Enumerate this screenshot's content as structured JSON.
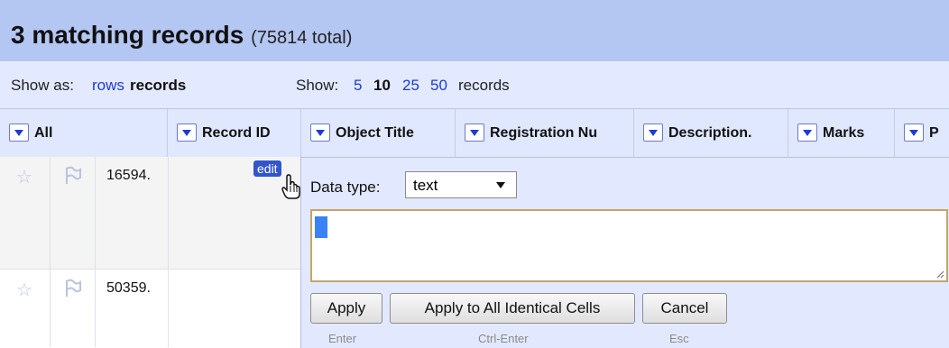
{
  "header": {
    "count_text": "3 matching records",
    "total_text": "(75814 total)"
  },
  "view_bar": {
    "show_as_label": "Show as:",
    "rows_link": "rows",
    "records_label": "records",
    "show_label": "Show:",
    "page_sizes": [
      "5",
      "10",
      "25",
      "50"
    ],
    "page_size_suffix": "records"
  },
  "columns": [
    {
      "label": "All"
    },
    {
      "label": "Record ID"
    },
    {
      "label": "Object Title"
    },
    {
      "label": "Registration Nu"
    },
    {
      "label": "Description."
    },
    {
      "label": "Marks"
    },
    {
      "label": "P"
    }
  ],
  "rows": [
    {
      "id": "16594."
    },
    {
      "id": "50359."
    }
  ],
  "edit_link": "edit",
  "editor": {
    "data_type_label": "Data type:",
    "data_type_value": "text",
    "buttons": [
      {
        "label": "Apply",
        "hint": "Enter"
      },
      {
        "label": "Apply to All Identical Cells",
        "hint": "Ctrl-Enter"
      },
      {
        "label": "Cancel",
        "hint": "Esc"
      }
    ]
  }
}
